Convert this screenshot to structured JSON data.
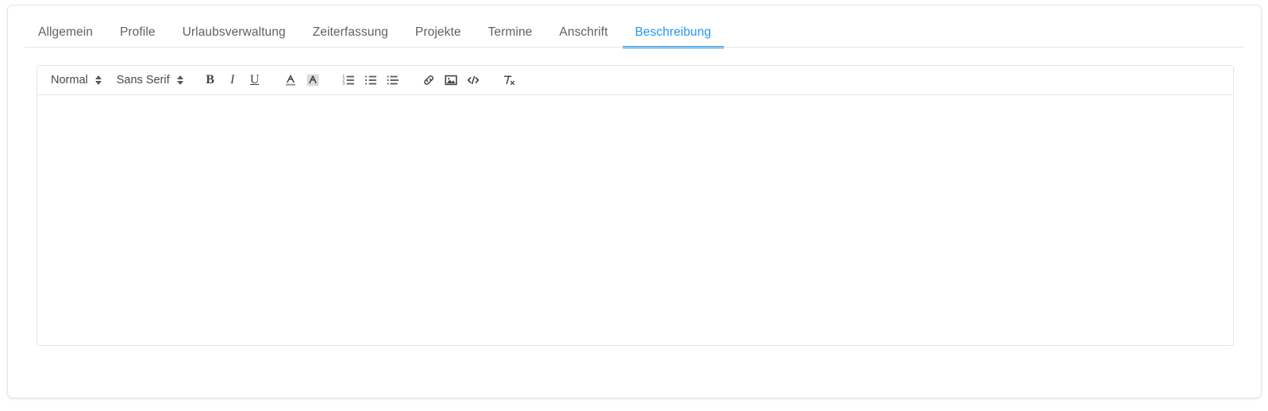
{
  "tabs": [
    {
      "label": "Allgemein",
      "active": false
    },
    {
      "label": "Profile",
      "active": false
    },
    {
      "label": "Urlaubsverwaltung",
      "active": false
    },
    {
      "label": "Zeiterfassung",
      "active": false
    },
    {
      "label": "Projekte",
      "active": false
    },
    {
      "label": "Termine",
      "active": false
    },
    {
      "label": "Anschrift",
      "active": false
    },
    {
      "label": "Beschreibung",
      "active": true
    }
  ],
  "editor": {
    "header_select": {
      "value": "Normal",
      "icon": "updown-chevron-icon"
    },
    "font_select": {
      "value": "Sans Serif",
      "icon": "updown-chevron-icon"
    },
    "buttons": [
      {
        "name": "bold-button",
        "glyph": "B"
      },
      {
        "name": "italic-button",
        "glyph": "I"
      },
      {
        "name": "underline-button",
        "glyph": "U"
      },
      {
        "name": "text-color-button",
        "glyph": "A"
      },
      {
        "name": "background-color-button",
        "glyph": "A"
      },
      {
        "name": "ordered-list-button",
        "glyph": ""
      },
      {
        "name": "bullet-list-button",
        "glyph": ""
      },
      {
        "name": "align-button",
        "glyph": ""
      },
      {
        "name": "link-button",
        "glyph": ""
      },
      {
        "name": "image-button",
        "glyph": ""
      },
      {
        "name": "code-block-button",
        "glyph": ""
      },
      {
        "name": "clear-formatting-button",
        "glyph": ""
      }
    ],
    "content": "",
    "placeholder": ""
  },
  "colors": {
    "accent": "#2196f3",
    "tab_text": "#5b6268",
    "border": "#e4e6e8",
    "icon": "#444a4f",
    "card_bg": "#ffffff"
  }
}
